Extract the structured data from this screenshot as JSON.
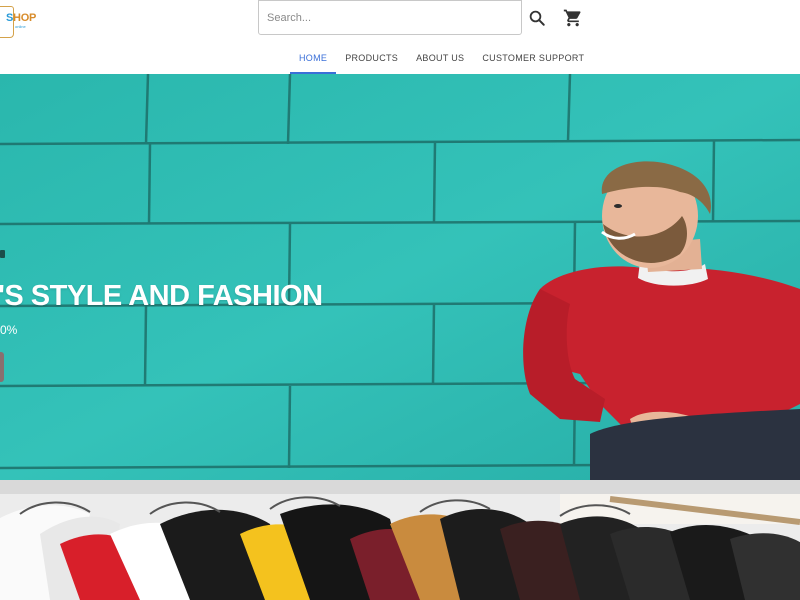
{
  "header": {
    "logo": {
      "text_main": "SHOP",
      "text_sub": "online"
    },
    "search": {
      "placeholder": "Search..."
    },
    "icons": {
      "search": "search-icon",
      "cart": "cart-icon"
    }
  },
  "nav": {
    "items": [
      {
        "label": "HOME",
        "active": true
      },
      {
        "label": "PRODUCTS",
        "active": false
      },
      {
        "label": "ABOUT US",
        "active": false
      },
      {
        "label": "CUSTOMER SUPPORT",
        "active": false
      }
    ]
  },
  "hero": {
    "title": "'S STYLE AND FASHION",
    "subtitle": "0%"
  },
  "colors": {
    "accent": "#3a6fd8",
    "wall": "#2fbdb4",
    "sweater": "#c8222e",
    "logo_orange": "#d88c2b",
    "logo_blue": "#2a9bd8"
  }
}
